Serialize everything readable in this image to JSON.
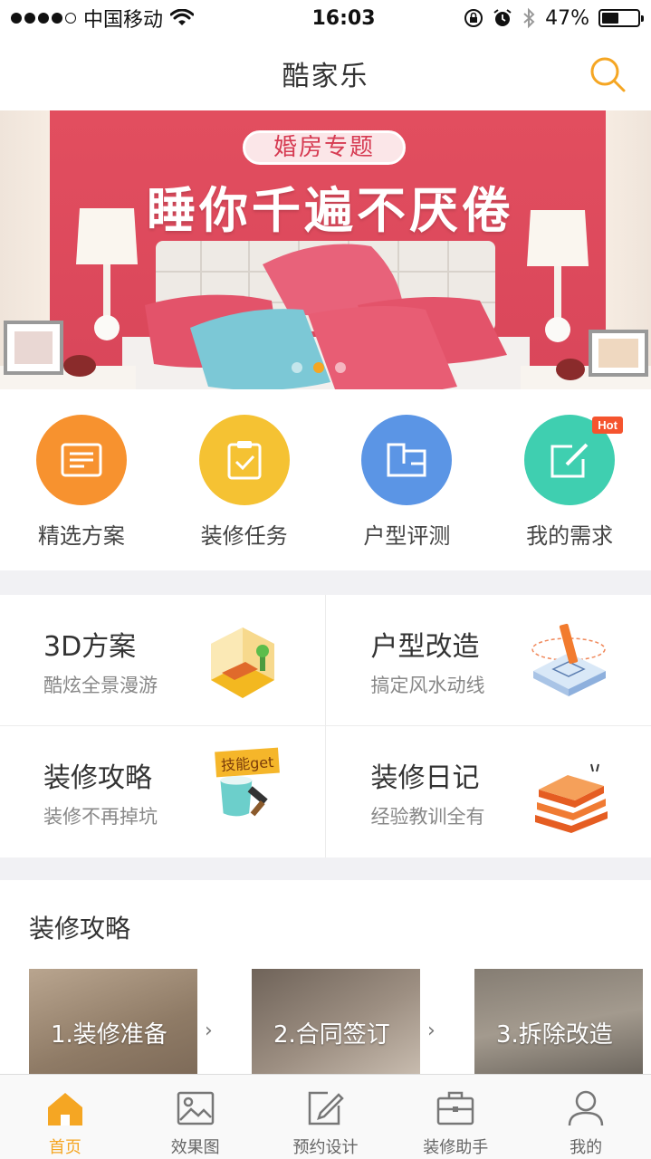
{
  "status_bar": {
    "carrier": "中国移动",
    "time": "16:03",
    "battery": "47%",
    "battery_level": 0.47
  },
  "nav": {
    "title": "酷家乐"
  },
  "banner": {
    "tag": "婚房专题",
    "headline": "睡你千遍不厌倦",
    "slide_count": 3,
    "active_slide": 2
  },
  "quick_nav": [
    {
      "label": "精选方案",
      "color": "#f7922f",
      "icon": "document-icon"
    },
    {
      "label": "装修任务",
      "color": "#f5c233",
      "icon": "clipboard-check-icon"
    },
    {
      "label": "户型评测",
      "color": "#5b95e5",
      "icon": "floorplan-icon"
    },
    {
      "label": "我的需求",
      "color": "#3fcfb0",
      "icon": "edit-icon",
      "badge": "Hot"
    }
  ],
  "features": [
    {
      "title": "3D方案",
      "subtitle": "酷炫全景漫游"
    },
    {
      "title": "户型改造",
      "subtitle": "搞定风水动线"
    },
    {
      "title": "装修攻略",
      "subtitle": "装修不再掉坑",
      "sticker": "技能get"
    },
    {
      "title": "装修日记",
      "subtitle": "经验教训全有"
    }
  ],
  "guide": {
    "title": "装修攻略",
    "cards": [
      {
        "label": "1.装修准备"
      },
      {
        "label": "2.合同签订"
      },
      {
        "label": "3.拆除改造"
      }
    ]
  },
  "tabs": [
    {
      "label": "首页",
      "icon": "home-icon",
      "active": true
    },
    {
      "label": "效果图",
      "icon": "image-icon",
      "active": false
    },
    {
      "label": "预约设计",
      "icon": "pencil-square-icon",
      "active": false
    },
    {
      "label": "装修助手",
      "icon": "briefcase-icon",
      "active": false
    },
    {
      "label": "我的",
      "icon": "user-icon",
      "active": false
    }
  ],
  "colors": {
    "accent": "#f5a623",
    "banner_wall": "#e24e5f"
  }
}
